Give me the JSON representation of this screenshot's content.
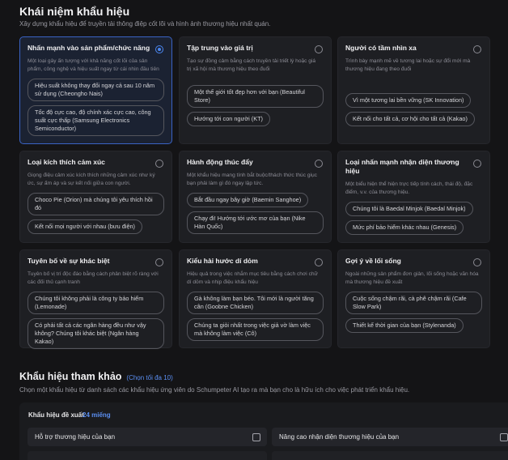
{
  "concept": {
    "title": "Khái niệm khẩu hiệu",
    "description": "Xây dựng khẩu hiệu để truyền tải thông điệp cốt lõi và hình ảnh thương hiệu nhất quán."
  },
  "cards": [
    {
      "title": "Nhấn mạnh vào sản phẩm/chức năng",
      "description": "Một loại gây ấn tượng với khả năng cốt lõi của sản phẩm, công nghệ và hiệu suất ngay từ cái nhìn đầu tiên",
      "selected": true,
      "examples": [
        "Hiệu suất không thay đổi ngay cả sau 10 năm sử dụng (Cheongho Nais)",
        "Tốc độ cực cao, độ chính xác cực cao, công suất cực thấp (Samsung Electronics Semiconductor)"
      ]
    },
    {
      "title": "Tập trung vào giá trị",
      "description": "Tạo sự đồng cảm bằng cách truyền tải triết lý hoặc giá trị xã hội mà thương hiệu theo đuổi",
      "selected": false,
      "examples": [
        "Một thế giới tốt đẹp hơn với bạn (Beautiful Store)",
        "Hướng tới con người (KT)"
      ]
    },
    {
      "title": "Người có tầm nhìn xa",
      "description": "Trình bày mạnh mẽ về tương lai hoặc sự đổi mới mà thương hiệu đang theo đuổi",
      "selected": false,
      "examples": [
        "Vì một tương lai bền vững (SK Innovation)",
        "Kết nối cho tất cả, cơ hội cho tất cả (Kakao)"
      ]
    },
    {
      "title": "Loại kích thích cảm xúc",
      "description": "Giọng điệu cảm xúc kích thích những cảm xúc như ký ức, sự ấm áp và sự kết nối giữa con người.",
      "selected": false,
      "examples": [
        "Choco Pie (Orion) mà chúng tôi yêu thích hồi đó",
        "Kết nối mọi người với nhau (bưu điện)"
      ]
    },
    {
      "title": "Hành động thúc đẩy",
      "description": "Một khẩu hiệu mang tính bắt buộc/thách thức thúc giục bạn phải làm gì đó ngay lập tức.",
      "selected": false,
      "examples": [
        "Bắt đầu ngay bây giờ (Baemin Sanghoe)",
        "Chạy đi! Hướng tới ước mơ của bạn (Nike Hàn Quốc)"
      ]
    },
    {
      "title": "Loại nhấn mạnh nhận diện thương hiệu",
      "description": "Một biểu hiện thể hiện trực tiếp tính cách, thái độ, đặc điểm, v.v. của thương hiệu.",
      "selected": false,
      "examples": [
        "Chúng tôi là Baedal Minjok (Baedal Minjok)",
        "Mức phí bảo hiểm khác nhau (Genesis)"
      ]
    },
    {
      "title": "Tuyên bố về sự khác biệt",
      "description": "Tuyên bố vị trí độc đáo bằng cách phân biệt rõ ràng với các đối thủ cạnh tranh",
      "selected": false,
      "examples": [
        "Chúng tôi không phải là công ty bảo hiểm (Lemonade)",
        "Có phải tất cả các ngân hàng đều như vậy không? Chúng tôi khác biệt (Ngân hàng Kakao)"
      ]
    },
    {
      "title": "Kiểu hài hước dí dỏm",
      "description": "Hiệu quả trong việc nhắm mục tiêu bằng cách chơi chữ dí dỏm và nhịp điệu khẩu hiệu",
      "selected": false,
      "examples": [
        "Gà không làm bạn béo. Tôi mới là người tăng cân (Goobne Chicken)",
        "Chúng ta giỏi nhất trong việc giả vờ làm việc mà không làm việc (Cô)"
      ]
    },
    {
      "title": "Gợi ý về lối sống",
      "description": "Ngoài những sản phẩm đơn giản, lối sống hoặc văn hóa mà thương hiệu đề xuất",
      "selected": false,
      "examples": [
        "Cuộc sống chậm rãi, cà phê chậm rãi (Cafe Slow Park)",
        "Thiết kế thời gian của bạn (Stylenanda)"
      ]
    }
  ],
  "reference": {
    "title": "Khẩu hiệu tham khảo",
    "link": "(Chọn tối đa 10)",
    "description": "Chọn một khẩu hiệu từ danh sách các khẩu hiệu ứng viên do Schumpeter AI tạo ra mà bạn cho là hữu ích cho việc phát triển khẩu hiệu.",
    "suggested_label": "Khẩu hiệu đề xuất",
    "suggested_count": "24 miếng",
    "items": [
      {
        "label": "Hỗ trợ thương hiệu của bạn",
        "checked": false
      },
      {
        "label": "Nâng cao nhận diện thương hiệu của bạn",
        "checked": false
      }
    ]
  },
  "colors": {
    "accent": "#4a86f0",
    "link": "#5b8ff2",
    "background": "#141416",
    "card": "#1e1f23"
  }
}
